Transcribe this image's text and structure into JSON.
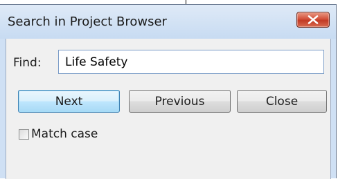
{
  "window": {
    "title": "Search in Project Browser",
    "close_icon": "close-icon"
  },
  "find": {
    "label": "Find:",
    "value": "Life Safety"
  },
  "buttons": {
    "next": "Next",
    "previous": "Previous",
    "close": "Close"
  },
  "options": {
    "match_case_label": "Match case",
    "match_case_checked": false
  },
  "colors": {
    "close_button": "#c23a24",
    "default_button_border": "#3c7fb1"
  }
}
